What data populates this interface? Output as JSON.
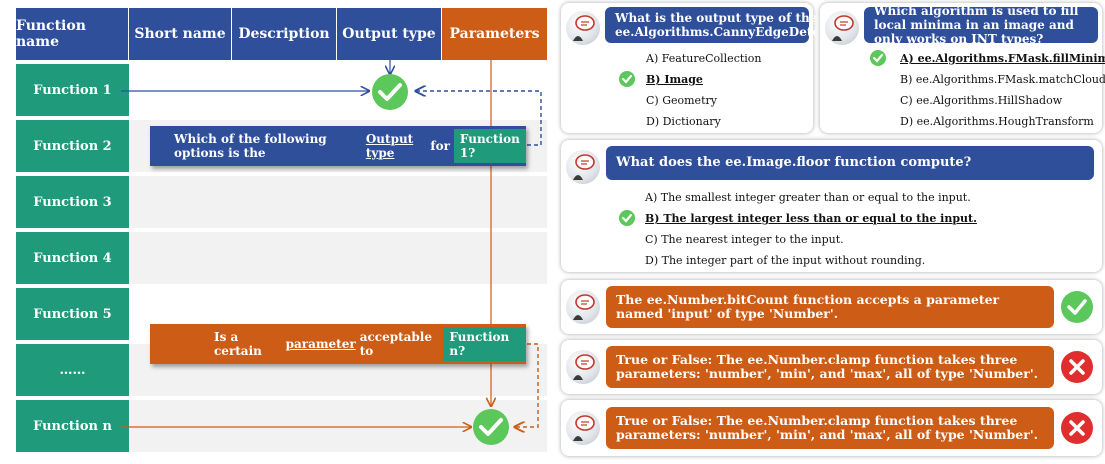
{
  "table": {
    "headers": [
      "Function name",
      "Short name",
      "Description",
      "Output type",
      "Parameters"
    ],
    "rows": [
      "Function 1",
      "Function 2",
      "Function 3",
      "Function 4",
      "Function 5",
      "……",
      "Function n"
    ],
    "callout1": {
      "prefix": "Which of the following options is the",
      "underlined": "Output type",
      "suffix": "for",
      "tag": "Function 1?"
    },
    "callout2": {
      "prefix": "Is a certain",
      "underlined": "parameter",
      "suffix": "acceptable to",
      "tag": "Function n?"
    }
  },
  "quiz": {
    "q1": {
      "question": "What is the output type of the ee.Algorithms.CannyEdgeDetector?",
      "options": [
        "A) FeatureCollection",
        "B) Image",
        "C) Geometry",
        "D) Dictionary"
      ],
      "correct_index": 1
    },
    "q2": {
      "question": "Which algorithm is used to fill local minima in an image and only works on INT types?",
      "options": [
        "A) ee.Algorithms.FMask.fillMinima",
        "B) ee.Algorithms.FMask.matchClouds",
        "C) ee.Algorithms.HillShadow",
        "D) ee.Algorithms.HoughTransform"
      ],
      "correct_index": 0
    },
    "q3": {
      "question": "What does the ee.Image.floor function compute?",
      "options": [
        "A) The smallest integer greater than or equal to the input.",
        "B) The largest integer less than or equal to the input.",
        "C) The nearest integer to the input.",
        "D) The integer part of the input without rounding."
      ],
      "correct_index": 1
    },
    "s1": {
      "statement": "The ee.Number.bitCount function accepts a parameter named 'input' of type 'Number'.",
      "result": "correct"
    },
    "s2": {
      "statement": "True or False: The ee.Number.clamp function takes three parameters: 'number', 'min', and 'max', all of type 'Number'.",
      "result": "incorrect"
    },
    "s3": {
      "statement": "True or False: The ee.Number.clamp function takes three parameters: 'number', 'min', and 'max', all of type 'Number'.",
      "result": "incorrect"
    }
  },
  "colors": {
    "blue": "#2f4f9b",
    "orange": "#cc5c16",
    "teal": "#1f9a7b",
    "green": "#5cc75a",
    "red": "#e02d2d"
  },
  "icons": [
    "chat-avatar-icon",
    "check-icon",
    "cross-icon",
    "arrow-icon"
  ]
}
